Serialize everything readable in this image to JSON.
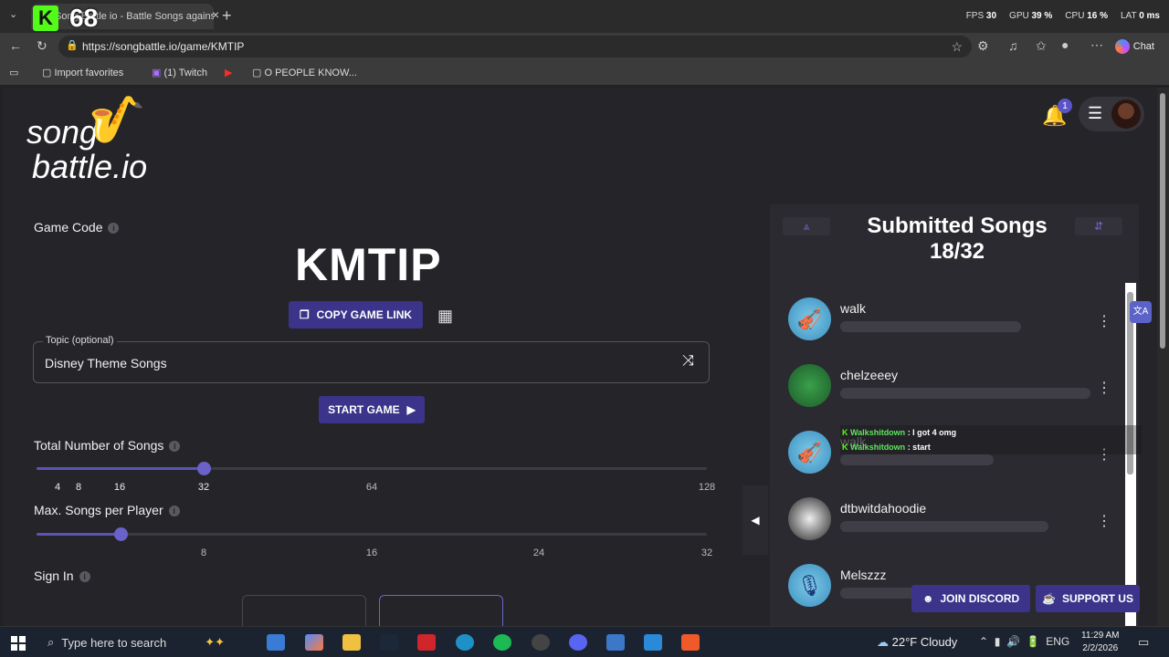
{
  "browser": {
    "tab_title": "Song Battle io - Battle Songs against",
    "overlay_count": "68",
    "perf": {
      "fps_label": "FPS",
      "fps": "30",
      "gpu_label": "GPU",
      "gpu": "39 %",
      "cpu_label": "CPU",
      "cpu": "16 %",
      "lat_label": "LAT",
      "lat": "0 ms"
    },
    "url": "https://songbattle.io/game/KMTIP",
    "chat_label": "Chat",
    "favorites": [
      {
        "label": "Import favorites"
      },
      {
        "label": "(1) Twitch"
      },
      {
        "label": "O PEOPLE KNOW..."
      }
    ]
  },
  "site": {
    "logo_line1": "song",
    "logo_line2": "battle.io",
    "notification_count": "1"
  },
  "game": {
    "code_label": "Game Code",
    "code": "KMTIP",
    "copy_link_label": "COPY GAME LINK",
    "topic_label": "Topic (optional)",
    "topic_value": "Disney Theme Songs",
    "start_label": "START GAME",
    "total_songs_label": "Total Number of Songs",
    "total_songs_ticks": [
      "4",
      "8",
      "16",
      "32",
      "64",
      "128"
    ],
    "total_songs_value": 32,
    "max_per_player_label": "Max. Songs per Player",
    "max_per_player_ticks": [
      "8",
      "16",
      "24",
      "32"
    ],
    "max_per_player_value": 4,
    "sign_in_label": "Sign In"
  },
  "submitted": {
    "title": "Submitted Songs",
    "count": "18/32",
    "players": [
      {
        "name": "walk"
      },
      {
        "name": "chelzeeey"
      },
      {
        "name": "walk"
      },
      {
        "name": "dtbwitdahoodie"
      },
      {
        "name": "Melszzz"
      }
    ]
  },
  "chat_overlay": [
    {
      "user": "Walkshitdown",
      "message": " : I got 4 omg"
    },
    {
      "user": "Walkshitdown",
      "message": " : start"
    }
  ],
  "footer_buttons": {
    "discord": "JOIN DISCORD",
    "support": "SUPPORT US"
  },
  "taskbar": {
    "search_placeholder": "Type here to search",
    "weather": "22°F  Cloudy",
    "language": "ENG",
    "time": "11:29 AM",
    "date": "2/2/2026"
  },
  "colors": {
    "accent": "#3b348a",
    "background": "#252429",
    "panel": "#2b2a30"
  }
}
